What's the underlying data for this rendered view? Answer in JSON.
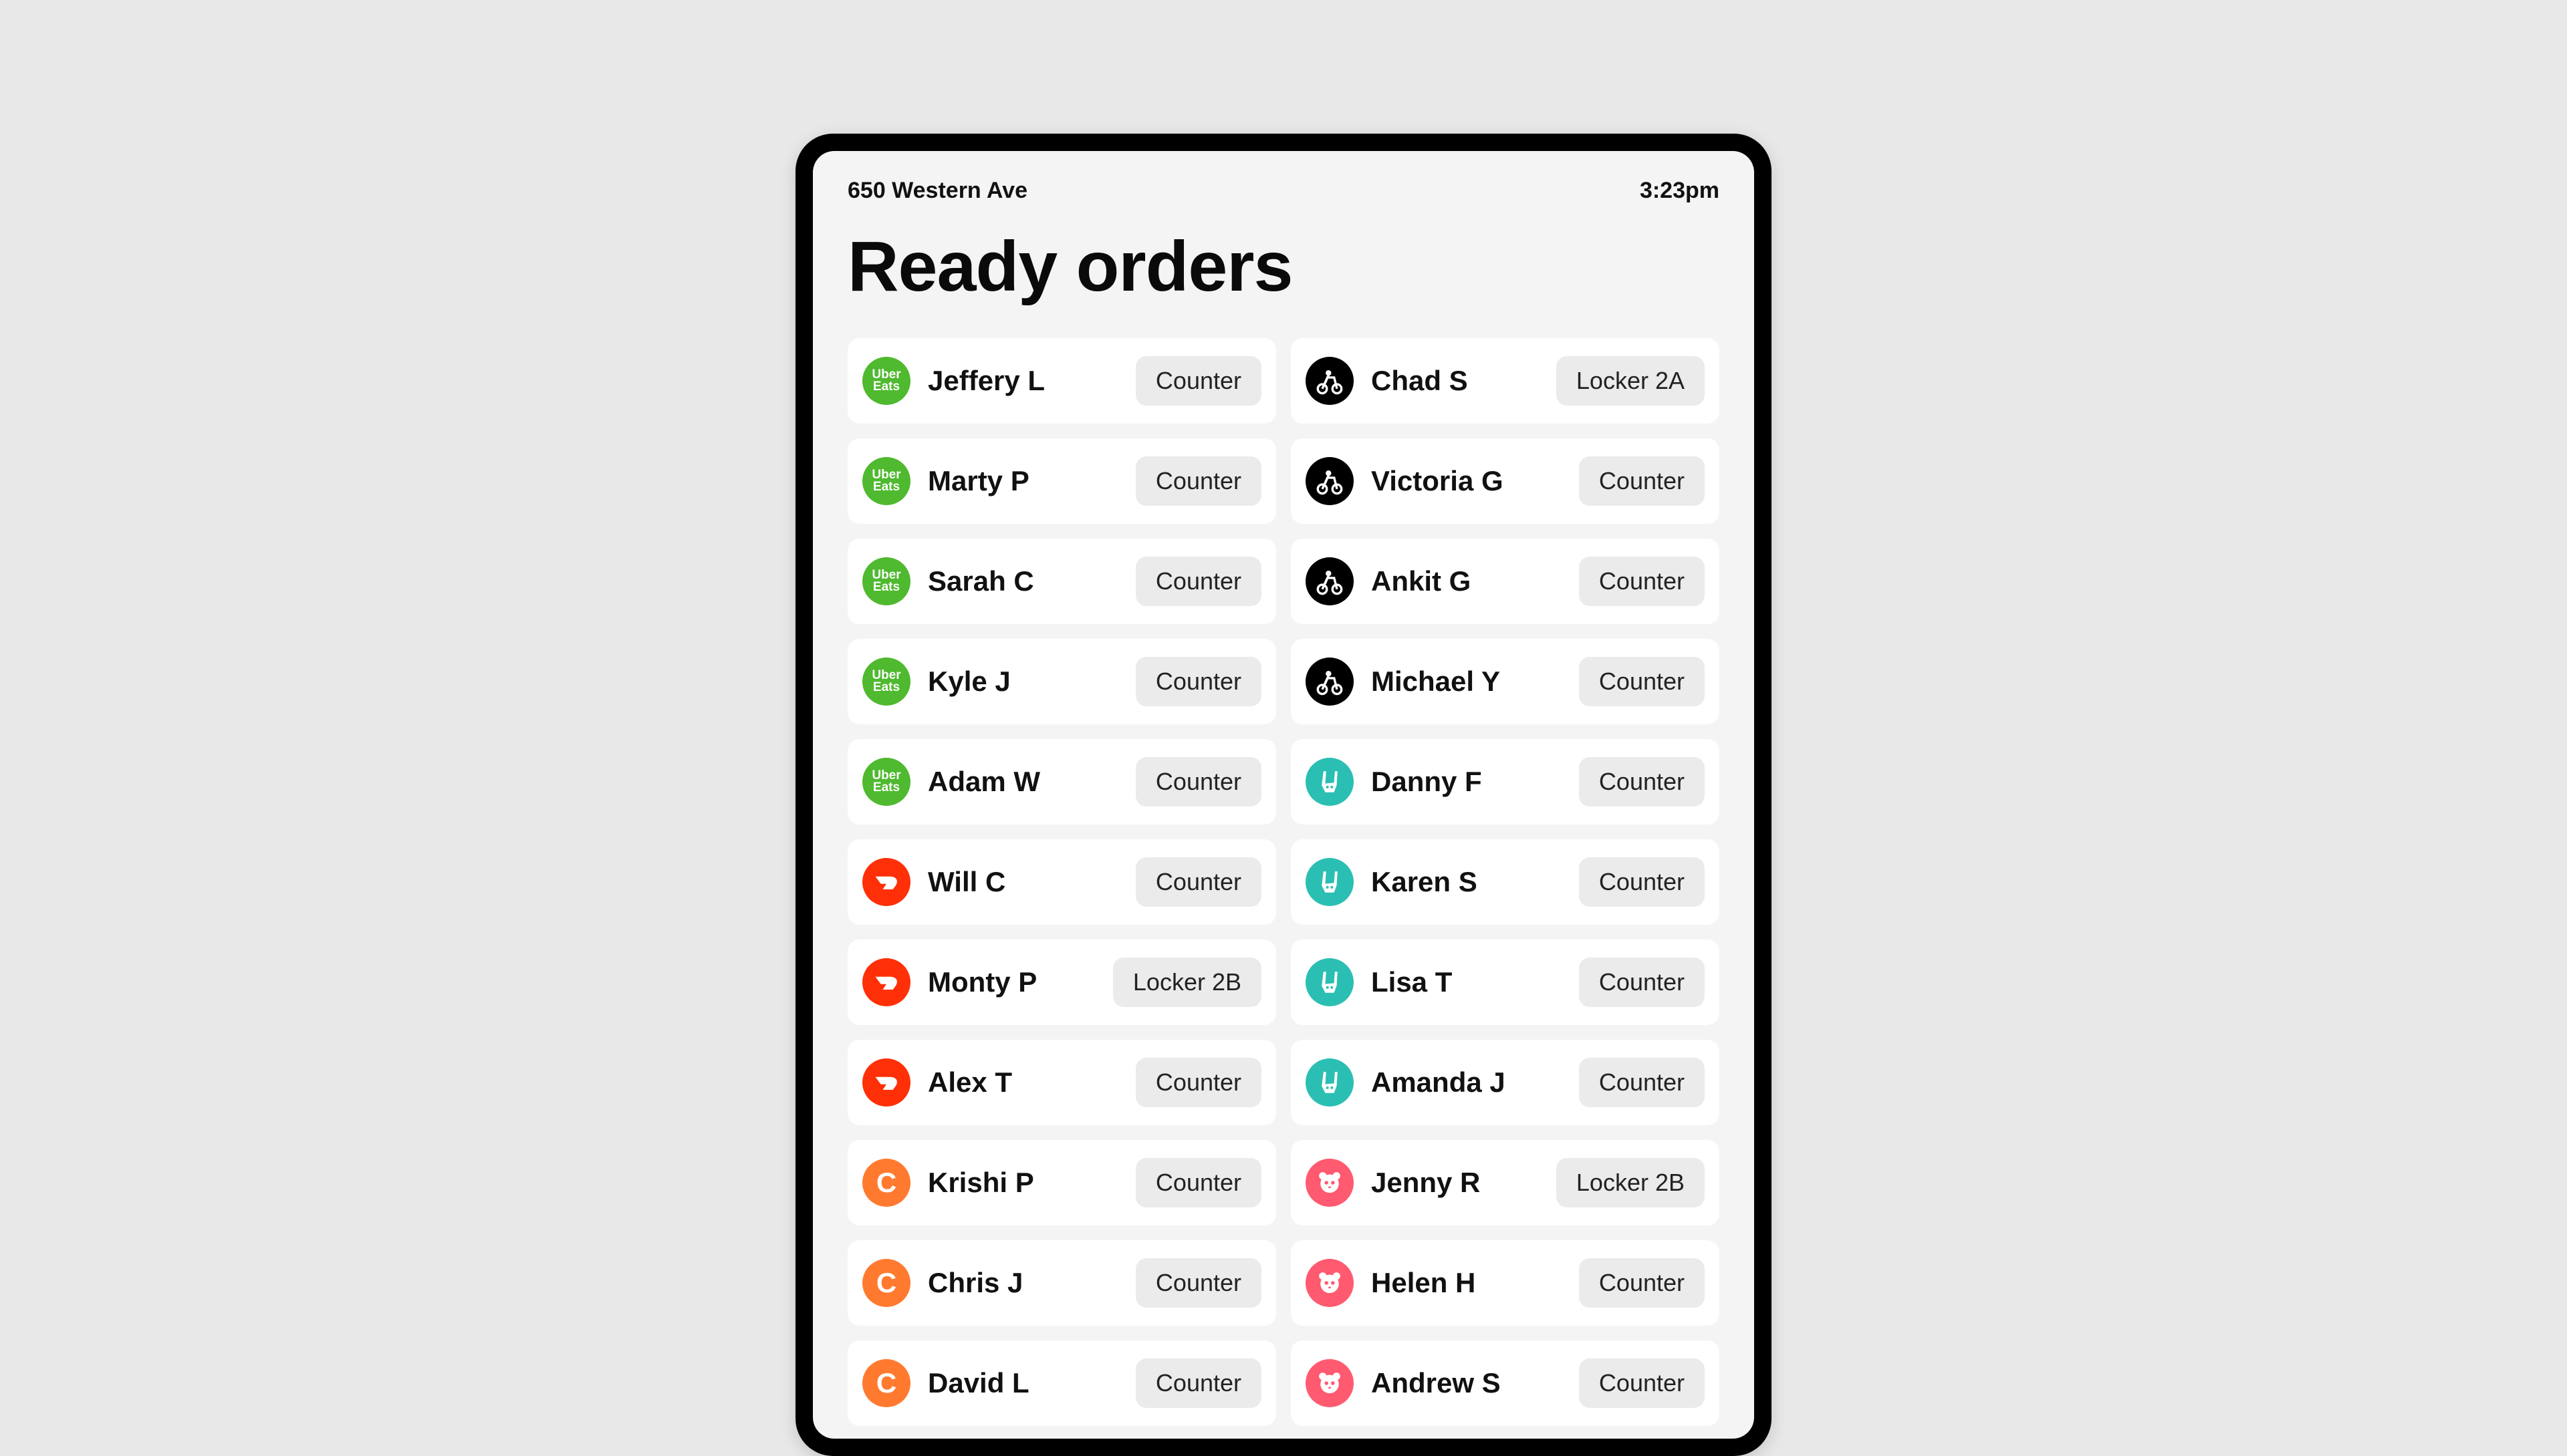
{
  "header": {
    "location": "650 Western Ave",
    "time": "3:23pm"
  },
  "title": "Ready orders",
  "brands": {
    "ubereats": {
      "bg": "#4fb92f",
      "label": "Uber Eats"
    },
    "postmates": {
      "bg": "#000000",
      "label": "Postmates"
    },
    "doordash": {
      "bg": "#ff3008",
      "label": "DoorDash"
    },
    "caviar": {
      "bg": "#ff7a2f",
      "label": "Caviar"
    },
    "deliveroo": {
      "bg": "#2bbfb3",
      "label": "Deliveroo"
    },
    "foodpanda": {
      "bg": "#ff5a70",
      "label": "Foodpanda"
    }
  },
  "orders_left": [
    {
      "name": "Jeffery L",
      "badge": "Counter",
      "brand": "ubereats"
    },
    {
      "name": "Marty P",
      "badge": "Counter",
      "brand": "ubereats"
    },
    {
      "name": "Sarah C",
      "badge": "Counter",
      "brand": "ubereats"
    },
    {
      "name": "Kyle J",
      "badge": "Counter",
      "brand": "ubereats"
    },
    {
      "name": "Adam W",
      "badge": "Counter",
      "brand": "ubereats"
    },
    {
      "name": "Will C",
      "badge": "Counter",
      "brand": "doordash"
    },
    {
      "name": "Monty P",
      "badge": "Locker 2B",
      "brand": "doordash"
    },
    {
      "name": "Alex T",
      "badge": "Counter",
      "brand": "doordash"
    },
    {
      "name": "Krishi P",
      "badge": "Counter",
      "brand": "caviar"
    },
    {
      "name": "Chris J",
      "badge": "Counter",
      "brand": "caviar"
    },
    {
      "name": "David L",
      "badge": "Counter",
      "brand": "caviar"
    }
  ],
  "orders_right": [
    {
      "name": "Chad S",
      "badge": "Locker 2A",
      "brand": "postmates"
    },
    {
      "name": "Victoria G",
      "badge": "Counter",
      "brand": "postmates"
    },
    {
      "name": "Ankit G",
      "badge": "Counter",
      "brand": "postmates"
    },
    {
      "name": "Michael Y",
      "badge": "Counter",
      "brand": "postmates"
    },
    {
      "name": "Danny F",
      "badge": "Counter",
      "brand": "deliveroo"
    },
    {
      "name": "Karen S",
      "badge": "Counter",
      "brand": "deliveroo"
    },
    {
      "name": "Lisa T",
      "badge": "Counter",
      "brand": "deliveroo"
    },
    {
      "name": "Amanda J",
      "badge": "Counter",
      "brand": "deliveroo"
    },
    {
      "name": "Jenny R",
      "badge": "Locker 2B",
      "brand": "foodpanda"
    },
    {
      "name": "Helen H",
      "badge": "Counter",
      "brand": "foodpanda"
    },
    {
      "name": "Andrew S",
      "badge": "Counter",
      "brand": "foodpanda"
    }
  ]
}
